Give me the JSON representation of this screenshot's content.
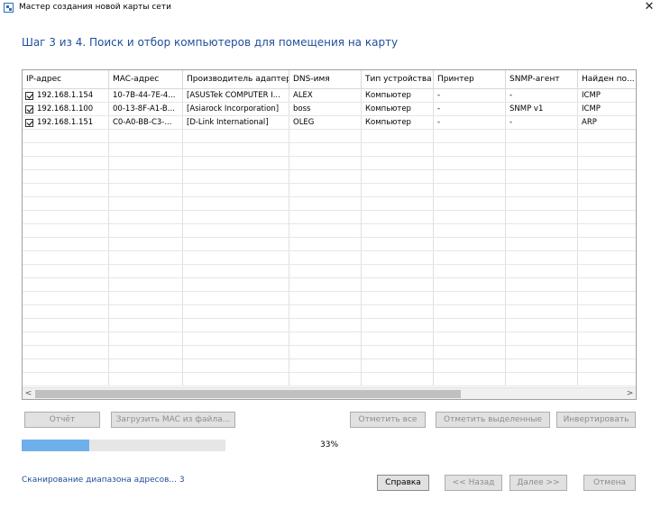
{
  "window": {
    "title": "Мастер создания новой карты сети",
    "close_glyph": "✕"
  },
  "heading": "Шаг 3 из 4. Поиск и отбор компьютеров для помещения на карту",
  "table": {
    "columns": [
      "IP-адрес",
      "MAC-адрес",
      "Производитель адаптера",
      "DNS-имя",
      "Тип устройства",
      "Принтер",
      "SNMP-агент",
      "Найден по..."
    ],
    "rows": [
      {
        "checked": true,
        "cells": [
          "192.168.1.154",
          "10-7B-44-7E-4...",
          "[ASUSTek COMPUTER I...",
          "ALEX",
          "Компьютер",
          "-",
          "-",
          "ICMP"
        ]
      },
      {
        "checked": true,
        "cells": [
          "192.168.1.100",
          "00-13-8F-A1-B...",
          "[Asiarock Incorporation]",
          "boss",
          "Компьютер",
          "-",
          "SNMP v1",
          "ICMP"
        ]
      },
      {
        "checked": true,
        "cells": [
          "192.168.1.151",
          "C0-A0-BB-C3-...",
          "[D-Link International]",
          "OLEG",
          "Компьютер",
          "-",
          "-",
          "ARP"
        ]
      }
    ]
  },
  "scrollbar": {
    "left_arrow": "<",
    "right_arrow": ">"
  },
  "buttons": {
    "report": "Отчёт",
    "load_mac": "Загрузить MAC из файла...",
    "check_all": "Отметить все",
    "check_selected": "Отметить выделенные",
    "invert": "Инвертировать",
    "help": "Справка",
    "back": "<< Назад",
    "next": "Далее >>",
    "cancel": "Отмена"
  },
  "progress": {
    "value": 0.33,
    "label": "33%"
  },
  "status": "Сканирование диапазона адресов... 3",
  "colors": {
    "heading": "#1f4e9a",
    "progress_fill": "#6fb0ec",
    "status": "#1f4e9a"
  }
}
